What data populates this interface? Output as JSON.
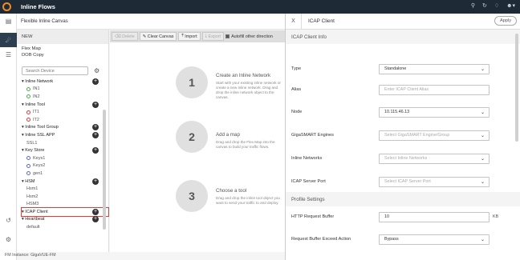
{
  "app": {
    "title": "Inline Flows"
  },
  "topbar": {
    "icons": [
      "search-icon",
      "refresh-icon",
      "bell-icon",
      "user-icon"
    ]
  },
  "canvas_header": {
    "title": "Flexible Inline Canvas"
  },
  "sidebar": {
    "new_label": "NEW",
    "maps": [
      "Flex Map",
      "DOB Copy"
    ],
    "search_placeholder": "Search Device",
    "tree": [
      {
        "label": "Inline Network",
        "kind": "group"
      },
      {
        "label": "IN1",
        "kind": "child"
      },
      {
        "label": "IN2",
        "kind": "child"
      },
      {
        "label": "Inline Tool",
        "kind": "group"
      },
      {
        "label": "IT1",
        "kind": "child"
      },
      {
        "label": "IT2",
        "kind": "child"
      },
      {
        "label": "Inline Tool Group",
        "kind": "group"
      },
      {
        "label": "Inline SSL APP",
        "kind": "group"
      },
      {
        "label": "SSL1",
        "kind": "child"
      },
      {
        "label": "Key Store",
        "kind": "group"
      },
      {
        "label": "Keys1",
        "kind": "child"
      },
      {
        "label": "Keys2",
        "kind": "child"
      },
      {
        "label": "gen1",
        "kind": "child"
      },
      {
        "label": "HSM",
        "kind": "group"
      },
      {
        "label": "Hsm1",
        "kind": "child"
      },
      {
        "label": "Hsm2",
        "kind": "child"
      },
      {
        "label": "HSM3",
        "kind": "child"
      },
      {
        "label": "ICAP Client",
        "kind": "group"
      },
      {
        "label": "Heartbeat",
        "kind": "group"
      },
      {
        "label": "default",
        "kind": "child"
      }
    ],
    "footer": "FM Instance: GigaVUE-FM"
  },
  "toolbar": {
    "delete": "Delete",
    "clear_canvas": "Clear Canvas",
    "import": "Import",
    "export": "Export",
    "autofill": "Autofill other direction"
  },
  "steps": [
    {
      "num": "1",
      "title": "Create an Inline Network",
      "desc": "Start with your existing inline network or create a new inline network. Drag and drop the inline network object to the canvas."
    },
    {
      "num": "2",
      "title": "Add a map",
      "desc": "Drag and drop the Flex Map into the canvas to build your traffic flows."
    },
    {
      "num": "3",
      "title": "Choose a tool",
      "desc": "Drag and drop the inline tool object you want to send your traffic to and deploy."
    }
  ],
  "panel": {
    "close": "X",
    "title": "ICAP Client",
    "apply": "Apply",
    "section_info": "ICAP Client Info",
    "fields": [
      {
        "label": "Type",
        "value": "Standalone",
        "placeholder": false,
        "select": true
      },
      {
        "label": "Alias",
        "value": "Enter ICAP Client Alias",
        "placeholder": true,
        "select": false
      },
      {
        "label": "Node",
        "value": "10.115.46.13",
        "placeholder": false,
        "select": true
      },
      {
        "label": "GigaSMART Engines",
        "value": "Select GigaSMART Engine/Group",
        "placeholder": true,
        "select": true
      },
      {
        "label": "Inline Networks",
        "value": "Select Inline Networks",
        "placeholder": true,
        "select": true
      },
      {
        "label": "ICAP Server Port",
        "value": "Select ICAP Server Port",
        "placeholder": true,
        "select": true
      }
    ],
    "section_profile": "Profile Settings",
    "profile_fields": [
      {
        "label": "HTTP Request Buffer",
        "value": "10",
        "unit": "KB"
      },
      {
        "label": "Request Buffer Exceed Action",
        "value": "Bypass",
        "select": true
      }
    ]
  }
}
